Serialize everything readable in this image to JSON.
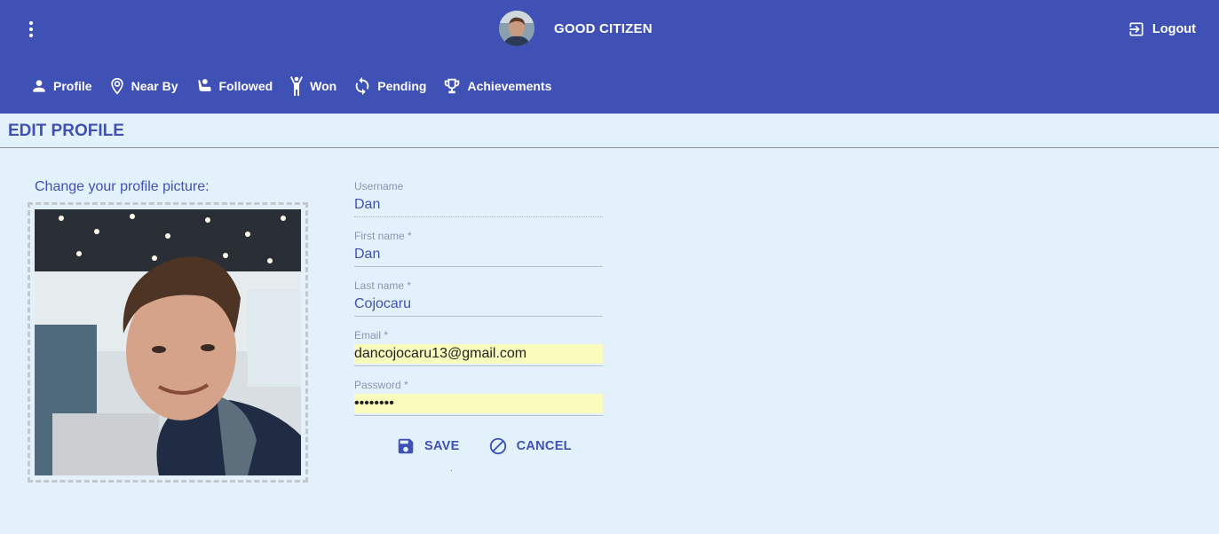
{
  "header": {
    "title": "GOOD CITIZEN",
    "menu_icon": "more-vert-icon",
    "logout_label": "Logout",
    "bg_color": "#3f51b5"
  },
  "nav": {
    "items": [
      {
        "label": "Profile",
        "icon": "person-icon"
      },
      {
        "label": "Near By",
        "icon": "location-pin-icon"
      },
      {
        "label": "Followed",
        "icon": "follow-icon"
      },
      {
        "label": "Won",
        "icon": "trophy-person-icon"
      },
      {
        "label": "Pending",
        "icon": "sync-icon"
      },
      {
        "label": "Achievements",
        "icon": "trophy-icon"
      }
    ]
  },
  "page": {
    "title": "EDIT PROFILE",
    "background": "#e3f1fc"
  },
  "picture": {
    "label": "Change your profile picture:"
  },
  "form": {
    "username": {
      "label": "Username",
      "value": "Dan"
    },
    "first_name": {
      "label": "First name *",
      "value": "Dan"
    },
    "last_name": {
      "label": "Last name *",
      "value": "Cojocaru"
    },
    "email": {
      "label": "Email *",
      "value": "dancojocaru13@gmail.com"
    },
    "password": {
      "label": "Password *",
      "value": "••••••••"
    }
  },
  "actions": {
    "save_label": "SAVE",
    "cancel_label": "CANCEL"
  }
}
